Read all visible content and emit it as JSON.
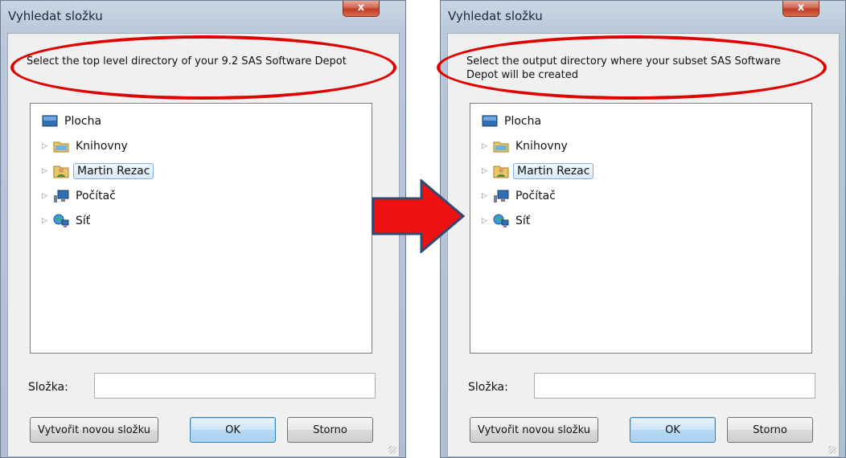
{
  "dialogs": [
    {
      "title": "Vyhledat složku",
      "close_label": "x",
      "prompt": "Select the top level directory of your 9.2 SAS Software Depot",
      "tree": [
        {
          "label": "Plocha",
          "icon": "desktop-icon",
          "expander": false,
          "selected": false
        },
        {
          "label": "Knihovny",
          "icon": "libraries-icon",
          "expander": true,
          "selected": false
        },
        {
          "label": "Martin Rezac",
          "icon": "user-folder-icon",
          "expander": true,
          "selected": true
        },
        {
          "label": "Počítač",
          "icon": "computer-icon",
          "expander": true,
          "selected": false
        },
        {
          "label": "Síť",
          "icon": "network-icon",
          "expander": true,
          "selected": false
        }
      ],
      "folder_label": "Složka:",
      "folder_value": "",
      "new_folder_label": "Vytvořit novou složku",
      "ok_label": "OK",
      "cancel_label": "Storno"
    },
    {
      "title": "Vyhledat složku",
      "close_label": "x",
      "prompt": "Select the output directory where your subset SAS Software Depot will be created",
      "tree": [
        {
          "label": "Plocha",
          "icon": "desktop-icon",
          "expander": false,
          "selected": false
        },
        {
          "label": "Knihovny",
          "icon": "libraries-icon",
          "expander": true,
          "selected": false
        },
        {
          "label": "Martin Rezac",
          "icon": "user-folder-icon",
          "expander": true,
          "selected": true
        },
        {
          "label": "Počítač",
          "icon": "computer-icon",
          "expander": true,
          "selected": false
        },
        {
          "label": "Síť",
          "icon": "network-icon",
          "expander": true,
          "selected": false
        }
      ],
      "folder_label": "Složka:",
      "folder_value": "",
      "new_folder_label": "Vytvořit novou složku",
      "ok_label": "OK",
      "cancel_label": "Storno"
    }
  ],
  "colors": {
    "highlight": "#e00000",
    "arrow_fill": "#ee1111",
    "arrow_stroke": "#2d4a72"
  }
}
